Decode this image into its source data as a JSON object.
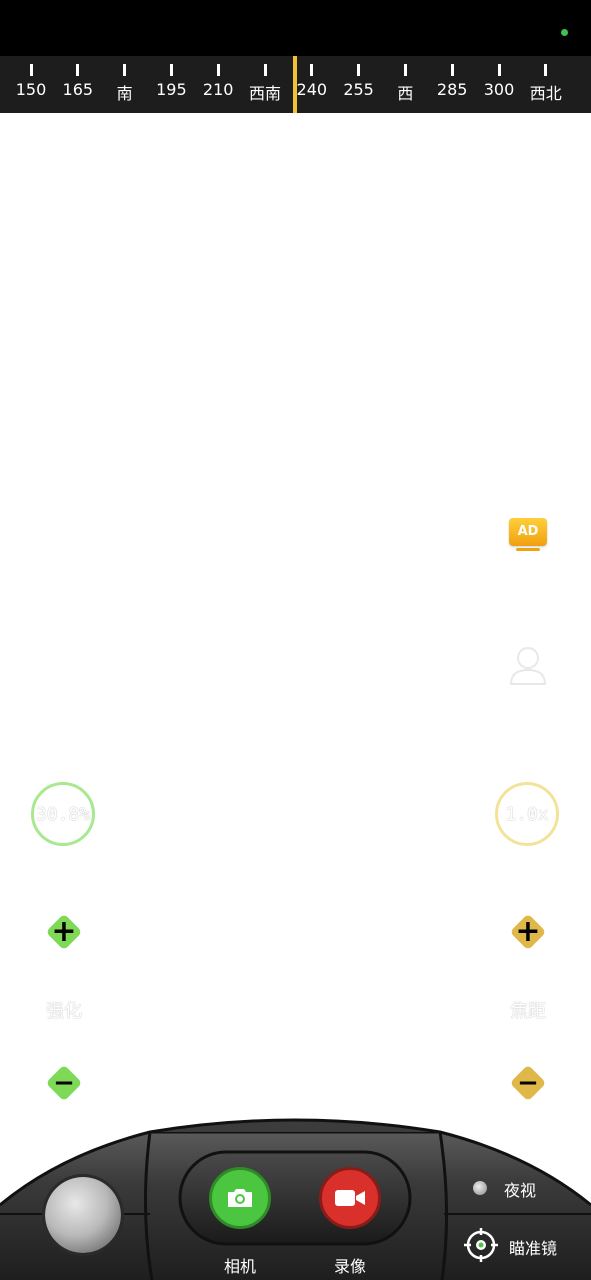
{
  "compass": {
    "ticks": [
      "150",
      "165",
      "南",
      "195",
      "210",
      "西南",
      "240",
      "255",
      "西",
      "285",
      "300",
      "西北"
    ],
    "accent": "#f2c230"
  },
  "ad": {
    "label": "AD"
  },
  "left_control": {
    "value": "30.8%",
    "label": "强化",
    "plus": "+",
    "minus": "−",
    "color": "#7ed957"
  },
  "right_control": {
    "value": "1.0x",
    "label": "焦距",
    "plus": "+",
    "minus": "−",
    "color": "#e0b84a"
  },
  "bottom_bar": {
    "camera_label": "相机",
    "record_label": "录像",
    "night_vision_label": "夜视",
    "scope_label": "瞄准镜",
    "camera_color": "#4cc640",
    "record_color": "#d9302b"
  }
}
